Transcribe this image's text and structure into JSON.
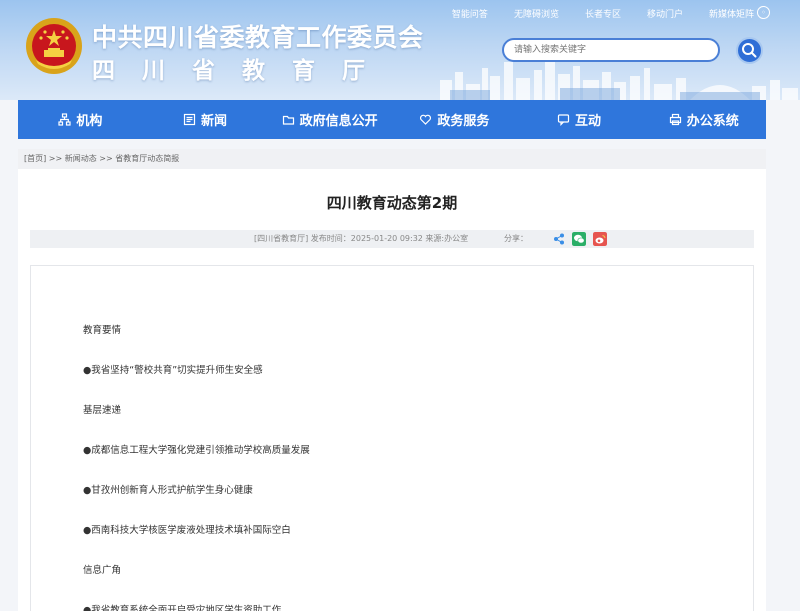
{
  "header": {
    "title": "中共四川省委教育工作委员会",
    "subtitle": "四川省教育厅",
    "top_links": [
      "智能问答",
      "无障碍浏览",
      "长者专区",
      "移动门户",
      "新媒体矩阵"
    ],
    "search_placeholder": "请输入搜索关键字"
  },
  "nav": {
    "items": [
      "机构",
      "新闻",
      "政府信息公开",
      "政务服务",
      "互动",
      "办公系统"
    ]
  },
  "breadcrumb": {
    "home": "[首页]",
    "sep1": ">>",
    "level1": "新闻动态",
    "sep2": ">>",
    "level2": "省教育厅动态简报"
  },
  "article": {
    "title": "四川教育动态第2期",
    "meta": "[四川省教育厅]  发布时间：2025-01-20 09:32  来源:办公室",
    "share_label": "分享：",
    "paragraphs": [
      "教育要情",
      "●我省坚持“警校共育”切实提升师生安全感",
      "基层速递",
      "●成都信息工程大学强化党建引领推动学校高质量发展",
      "●甘孜州创新育人形式护航学生身心健康",
      "●西南科技大学核医学废液处理技术填补国际空白",
      "信息广角",
      "●我省教育系统全面开启受灾地区学生资助工作"
    ]
  },
  "colors": {
    "nav_bg": "#2f76dc",
    "header_bg": "#9cc4ef",
    "wechat": "#2aae67",
    "weibo": "#e6544f",
    "share": "#3a8ee6"
  },
  "icons": {
    "search": "search-icon",
    "emblem": "national-emblem-icon",
    "share": "share-icon",
    "wechat": "wechat-icon",
    "weibo": "weibo-icon"
  }
}
